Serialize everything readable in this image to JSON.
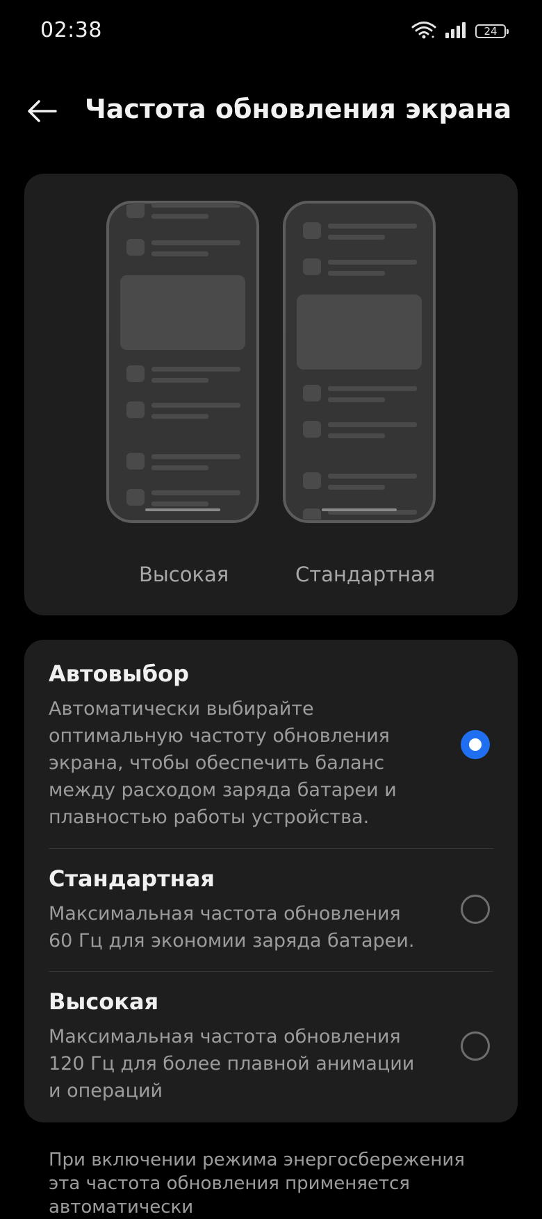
{
  "status_bar": {
    "time": "02:38",
    "battery_level": "24",
    "icons": [
      "wifi-icon",
      "signal-icon",
      "battery-icon"
    ]
  },
  "header": {
    "title": "Частота обновления экрана",
    "back_icon": "arrow-left-icon"
  },
  "preview": {
    "high_label": "Высокая",
    "standard_label": "Стандартная"
  },
  "options": [
    {
      "title": "Автовыбор",
      "description": "Автоматически выбирайте оптимальную частоту обновления экрана, чтобы обеспечить баланс между расходом заряда батареи и плавностью работы устройства.",
      "selected": true
    },
    {
      "title": "Стандартная",
      "description": "Максимальная частота обновления 60 Гц для экономии заряда батареи.",
      "selected": false
    },
    {
      "title": "Высокая",
      "description": "Максимальная частота обновления 120 Гц для более плавной анимации и операций",
      "selected": false
    }
  ],
  "footer_note": "При включении режима энергосбережения эта частота обновления применяется автоматически",
  "colors": {
    "background": "#000000",
    "card": "#1e1e1e",
    "accent": "#1f6ff0",
    "text_primary": "#f0f0f0",
    "text_secondary": "#9c9c9c"
  }
}
